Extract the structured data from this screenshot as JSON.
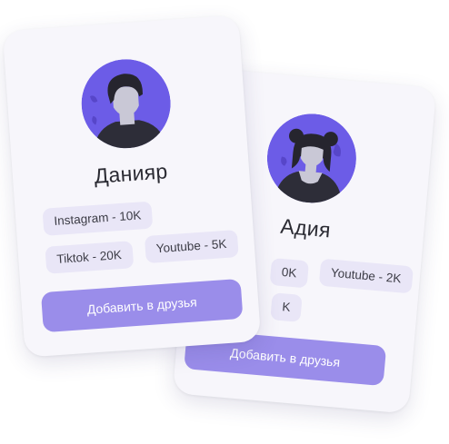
{
  "colors": {
    "accent": "#9a8dea",
    "avatar_bg": "#6c5ce7",
    "tag_bg": "#e9e6f7",
    "card_bg": "#f7f6fb"
  },
  "cards": [
    {
      "name": "Данияр",
      "avatar_icon": "male-user-avatar-icon",
      "tags": [
        "Instagram - 10K",
        "Tiktok - 20K",
        "Youtube - 5K"
      ],
      "button_label": "Добавить в друзья"
    },
    {
      "name": "Адия",
      "avatar_icon": "female-user-avatar-icon",
      "tags": [
        "0K",
        "Youtube - 2K",
        "K"
      ],
      "button_label": "Добавить в друзья"
    }
  ]
}
